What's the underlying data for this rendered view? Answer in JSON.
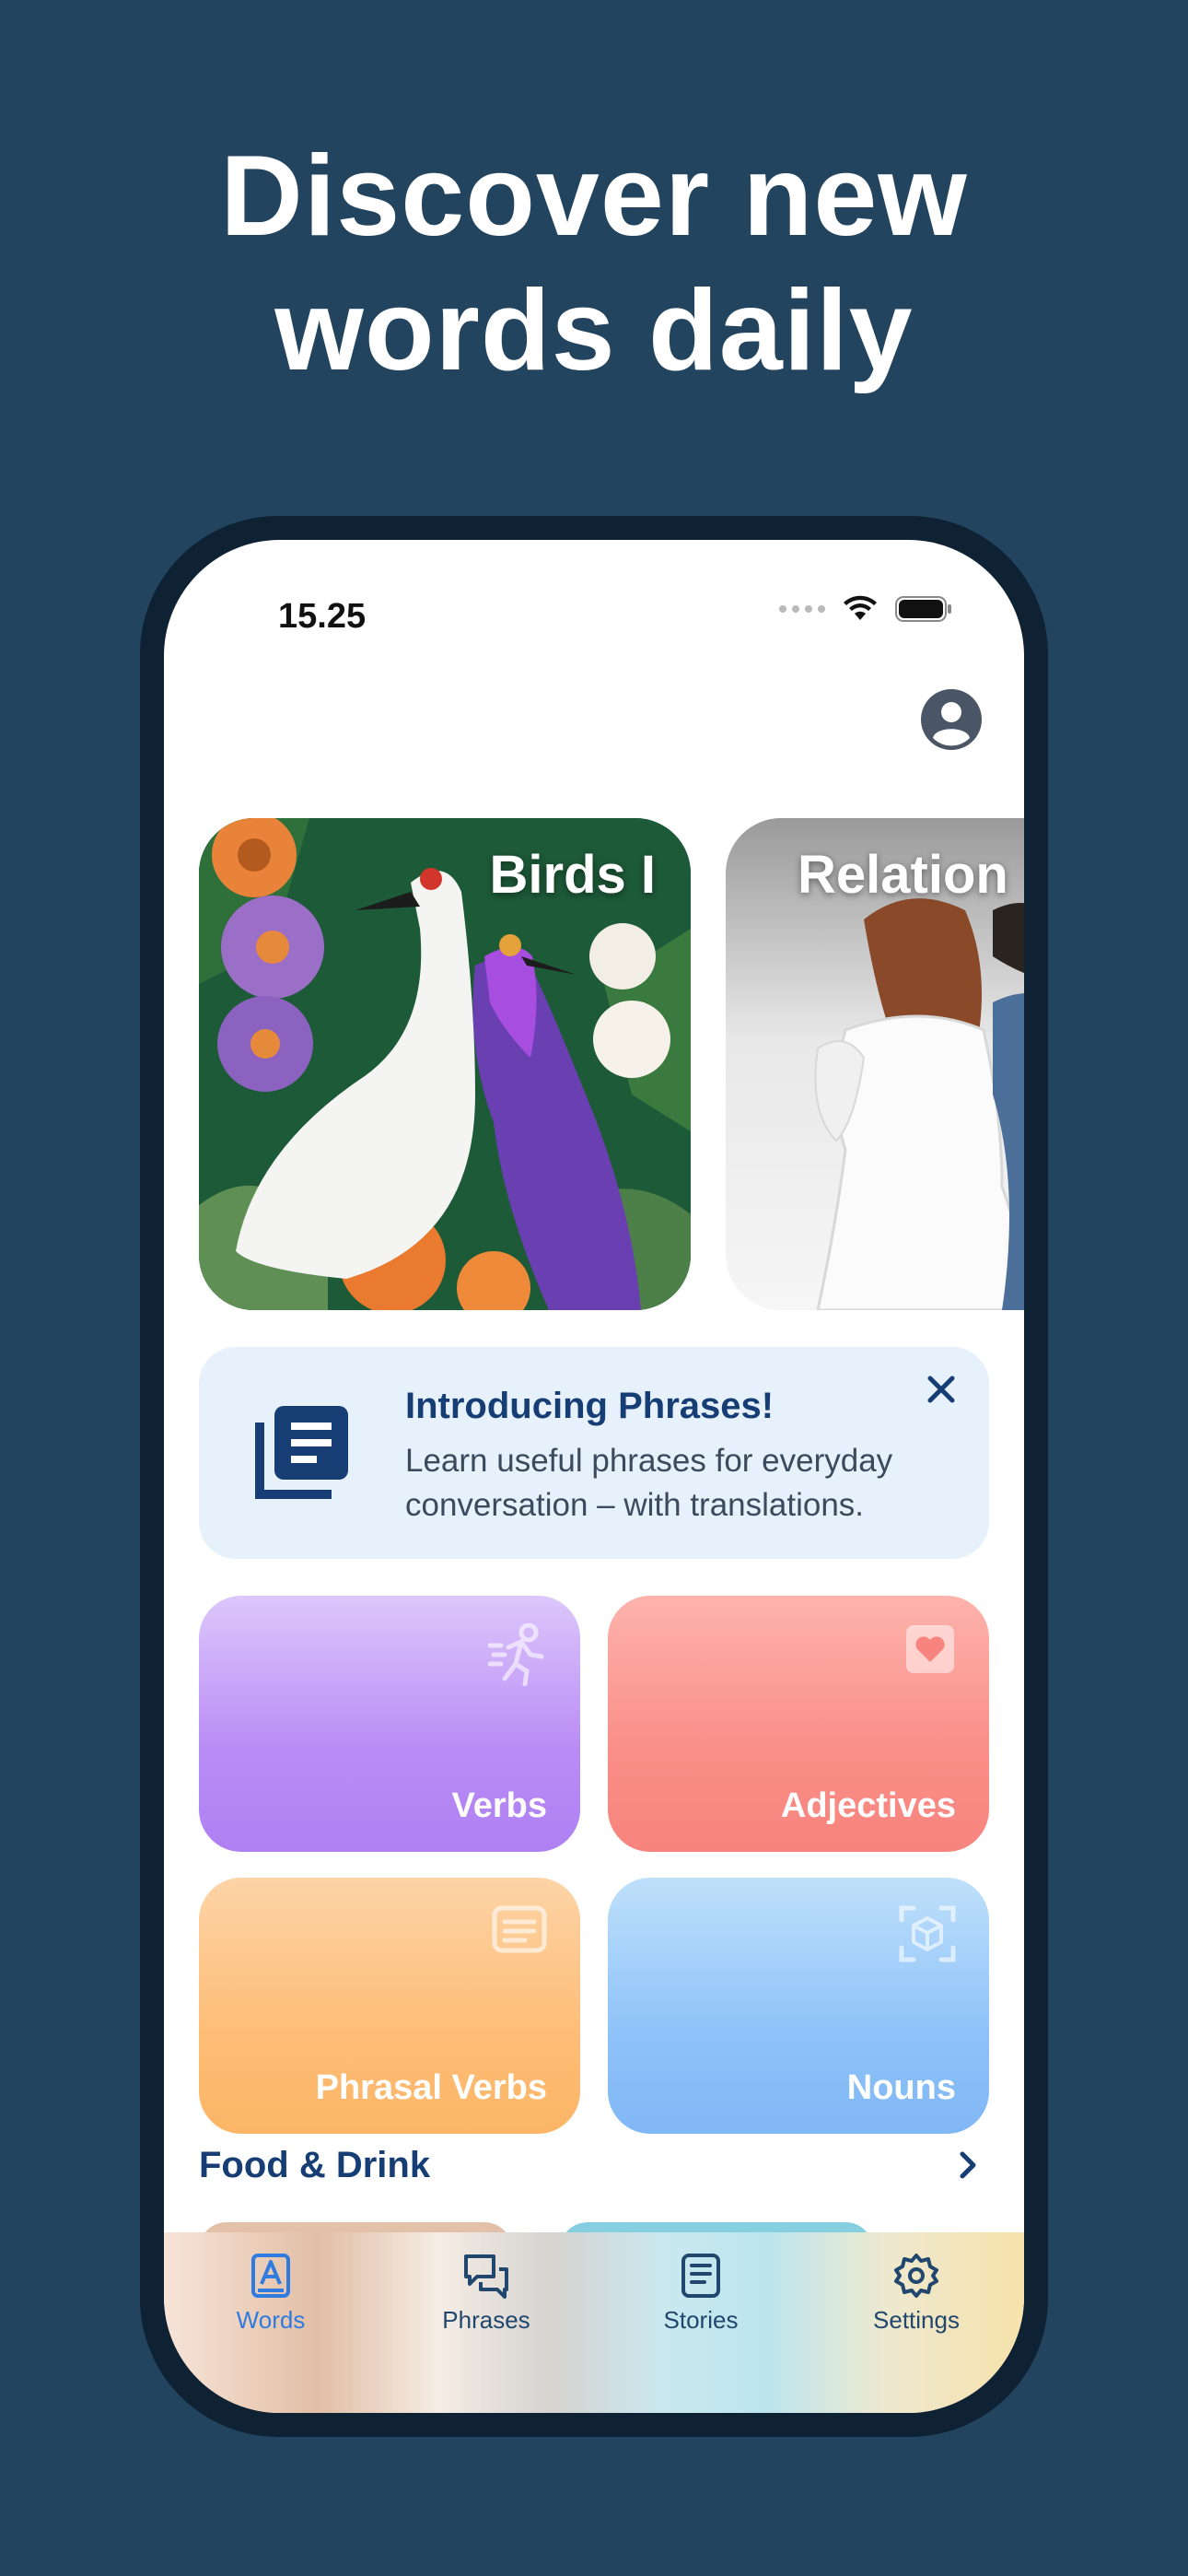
{
  "headline": {
    "line1": "Discover new",
    "line2": "words daily"
  },
  "status_bar": {
    "time": "15.25",
    "icons": [
      "signal-dots-icon",
      "wifi-icon",
      "battery-icon"
    ]
  },
  "profile": {
    "icon": "person-circle-icon"
  },
  "featured": [
    {
      "title": "Birds I"
    },
    {
      "title": "Relation"
    }
  ],
  "banner": {
    "title": "Introducing Phrases!",
    "text": "Learn useful phrases for everyday conversation – with translations.",
    "icon": "book-stack-icon",
    "close_icon": "close-icon"
  },
  "categories": [
    {
      "label": "Verbs",
      "icon": "running-person-icon",
      "color": "#b98cf5"
    },
    {
      "label": "Adjectives",
      "icon": "heart-card-icon",
      "color": "#fa8e88"
    },
    {
      "label": "Phrasal Verbs",
      "icon": "text-card-icon",
      "color": "#fdbd77"
    },
    {
      "label": "Nouns",
      "icon": "cube-scan-icon",
      "color": "#8ec2f8"
    }
  ],
  "section": {
    "title": "Food & Drink",
    "chevron": "chevron-right-icon"
  },
  "tabs": [
    {
      "label": "Words",
      "icon": "book-a-icon",
      "active": true
    },
    {
      "label": "Phrases",
      "icon": "chat-bubbles-icon",
      "active": false
    },
    {
      "label": "Stories",
      "icon": "document-icon",
      "active": false
    },
    {
      "label": "Settings",
      "icon": "gear-icon",
      "active": false
    }
  ],
  "colors": {
    "background": "#22445f",
    "accent": "#2f7be0",
    "navy": "#163e75"
  }
}
